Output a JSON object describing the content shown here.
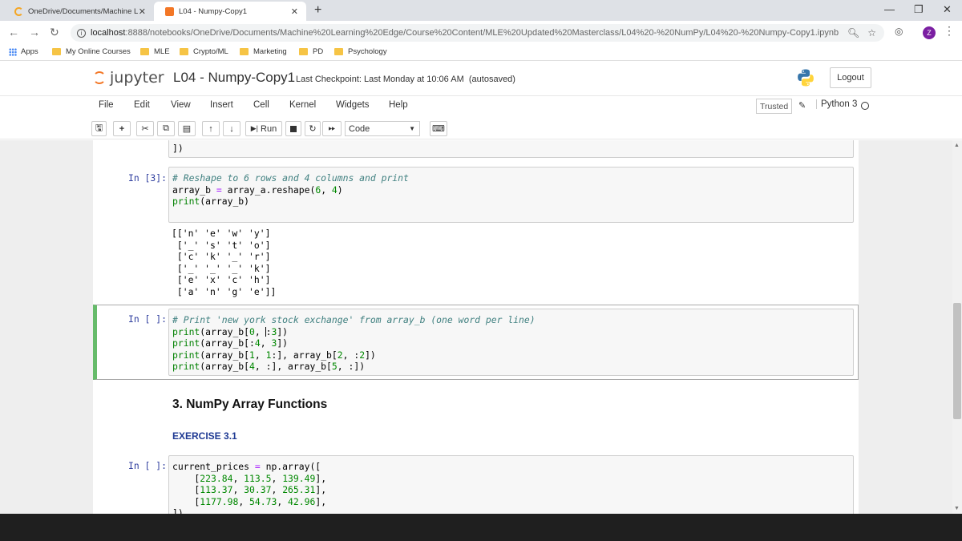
{
  "browser": {
    "tabs": [
      {
        "title": "OneDrive/Documents/Machine L",
        "active": false
      },
      {
        "title": "L04 - Numpy-Copy1",
        "active": true
      }
    ],
    "url_host": "localhost",
    "url_path": ":8888/notebooks/OneDrive/Documents/Machine%20Learning%20Edge/Course%20Content/MLE%20Updated%20Masterclass/L04%20-%20NumPy/L04%20-%20Numpy-Copy1.ipynb",
    "profile_initial": "Z",
    "bookmarks": [
      "Apps",
      "My Online Courses",
      "MLE",
      "Crypto/ML",
      "Marketing",
      "PD",
      "Psychology"
    ]
  },
  "jupyter": {
    "logo_text": "jupyter",
    "notebook_name": "L04 - Numpy-Copy1",
    "checkpoint": "Last Checkpoint: Last Monday at 10:06 AM",
    "autosave": "(autosaved)",
    "logout_label": "Logout",
    "menus": [
      "File",
      "Edit",
      "View",
      "Insert",
      "Cell",
      "Kernel",
      "Widgets",
      "Help"
    ],
    "trusted_label": "Trusted",
    "kernel_name": "Python 3",
    "run_label": "Run",
    "cell_type": "Code"
  },
  "cells": {
    "prev_tail": "])",
    "cell3": {
      "prompt": "In [3]:",
      "code": [
        "# Reshape to 6 rows and 4 columns and print",
        "array_b = array_a.reshape(6, 4)",
        "print(array_b)"
      ],
      "output": [
        "[['n' 'e' 'w' 'y']",
        " ['_' 's' 't' 'o']",
        " ['c' 'k' '_' 'r']",
        " ['_' '_' '_' 'k']",
        " ['e' 'x' 'c' 'h']",
        " ['a' 'n' 'g' 'e']]"
      ]
    },
    "cell4": {
      "prompt": "In [ ]:",
      "code": [
        "# Print 'new york stock exchange' from array_b (one word per line)",
        "print(array_b[0, :3])",
        "print(array_b[:4, 3])",
        "print(array_b[1, 1:], array_b[2, :2])",
        "print(array_b[4, :], array_b[5, :])"
      ]
    },
    "heading": "3. NumPy Array Functions",
    "exercise": "EXERCISE 3.1",
    "cell5": {
      "prompt": "In [ ]:",
      "code": [
        "current_prices = np.array([",
        "    [223.84, 113.5, 139.49],",
        "    [113.37, 30.37, 265.31],",
        "    [1177.98, 54.73, 42.96],",
        "])"
      ]
    }
  }
}
